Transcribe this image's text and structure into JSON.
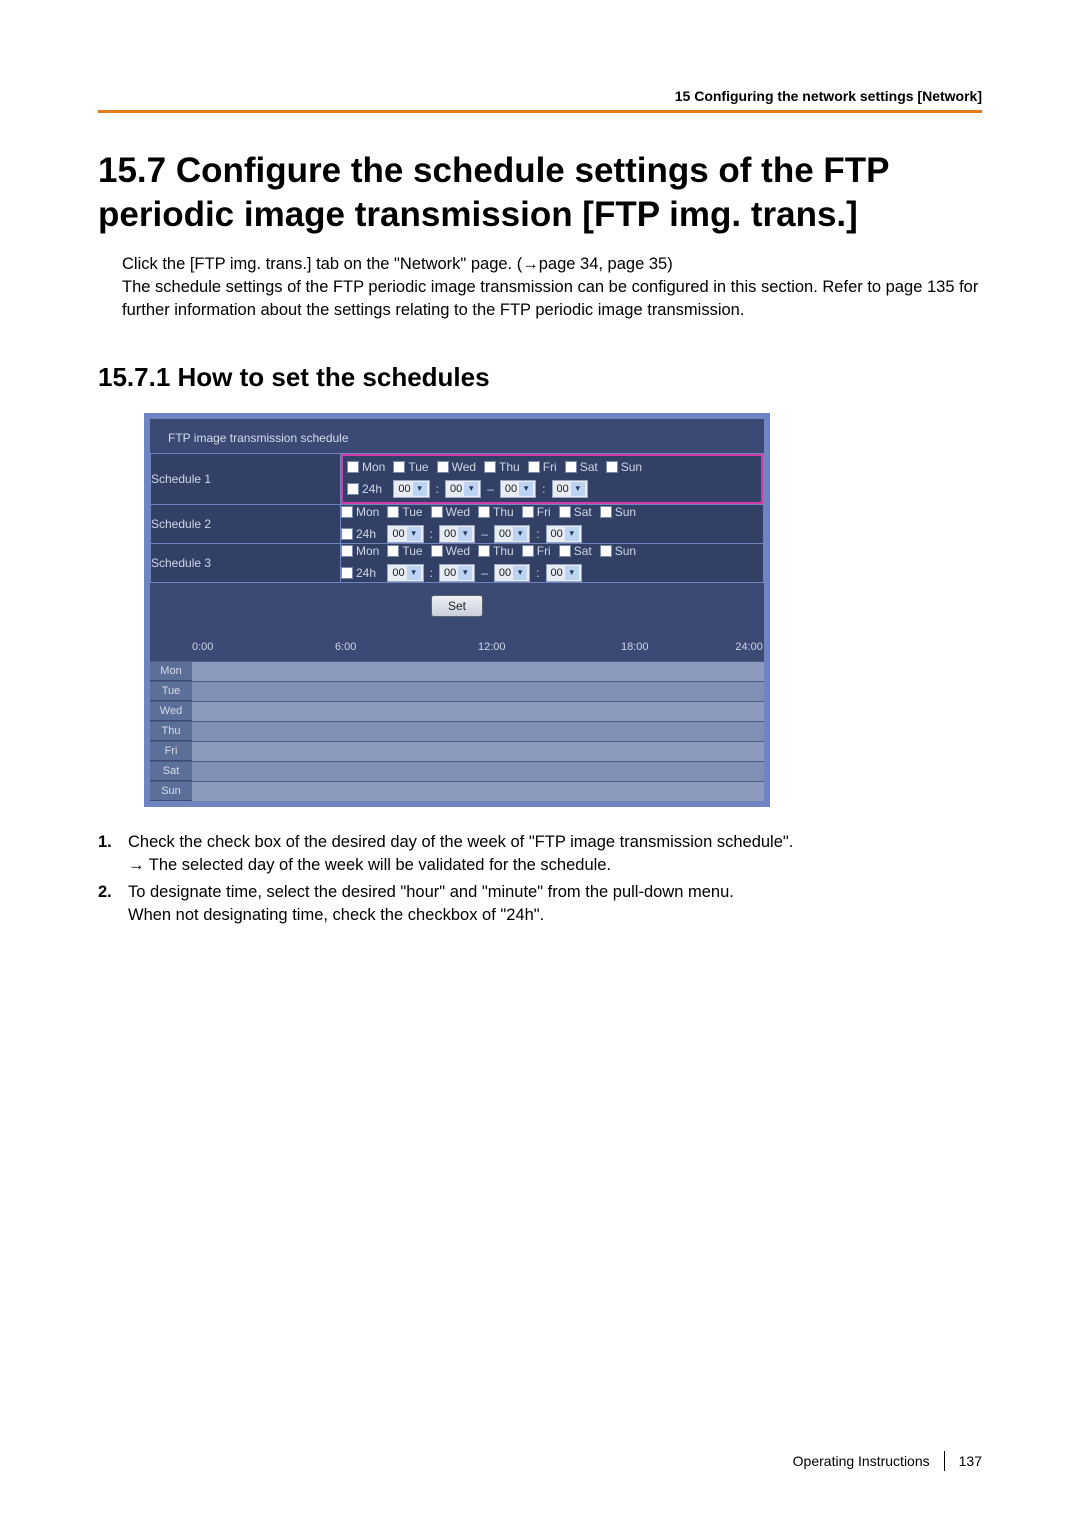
{
  "header": {
    "breadcrumb": "15 Configuring the network settings [Network]"
  },
  "title": "15.7  Configure the schedule settings of the FTP periodic image transmission [FTP img. trans.]",
  "intro": "Click the [FTP img. trans.] tab on the \"Network\" page. (→page 34, page 35)\nThe schedule settings of the FTP periodic image transmission can be configured in this section. Refer to page 135 for further information about the settings relating to the FTP periodic image transmission.",
  "subtitle": "15.7.1  How to set the schedules",
  "panel": {
    "title": "FTP image transmission schedule",
    "days": [
      "Mon",
      "Tue",
      "Wed",
      "Thu",
      "Fri",
      "Sat",
      "Sun"
    ],
    "label_24h": "24h",
    "time_value": "00",
    "schedules": [
      {
        "label": "Schedule 1",
        "highlight": true
      },
      {
        "label": "Schedule 2",
        "highlight": false
      },
      {
        "label": "Schedule 3",
        "highlight": false
      }
    ],
    "set_label": "Set",
    "timeline": {
      "ticks": [
        "0:00",
        "6:00",
        "12:00",
        "18:00",
        "24:00"
      ],
      "rows": [
        "Mon",
        "Tue",
        "Wed",
        "Thu",
        "Fri",
        "Sat",
        "Sun"
      ]
    }
  },
  "instructions": {
    "items": [
      {
        "num": "1.",
        "text": "Check the check box of the desired day of the week of \"FTP image transmission schedule\".",
        "sub": "→  The selected day of the week will be validated for the schedule."
      },
      {
        "num": "2.",
        "text": "To designate time, select the desired \"hour\" and \"minute\" from the pull-down menu.",
        "sub2": "When not designating time, check the checkbox of \"24h\"."
      }
    ]
  },
  "footer": {
    "label": "Operating Instructions",
    "page": "137"
  }
}
